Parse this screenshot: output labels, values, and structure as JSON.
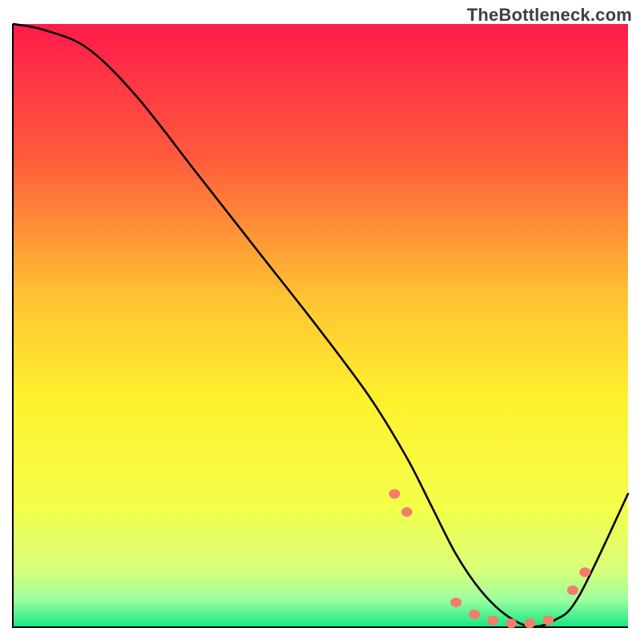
{
  "watermark": "TheBottleneck.com",
  "chart_data": {
    "type": "line",
    "title": "",
    "xlabel": "",
    "ylabel": "",
    "xlim": [
      0,
      100
    ],
    "ylim": [
      0,
      100
    ],
    "gradient_stops": [
      {
        "offset": 0.0,
        "color": "#ff1b4b"
      },
      {
        "offset": 0.22,
        "color": "#ff5a3c"
      },
      {
        "offset": 0.45,
        "color": "#ffc233"
      },
      {
        "offset": 0.62,
        "color": "#fff02e"
      },
      {
        "offset": 0.8,
        "color": "#f4ff4a"
      },
      {
        "offset": 0.905,
        "color": "#d8ff7a"
      },
      {
        "offset": 0.955,
        "color": "#9eff9e"
      },
      {
        "offset": 1.0,
        "color": "#17e884"
      }
    ],
    "series": [
      {
        "name": "bottleneck-curve",
        "x": [
          0,
          5,
          12,
          20,
          30,
          40,
          50,
          58,
          64,
          68,
          72,
          76,
          80,
          84,
          88,
          92,
          100
        ],
        "y": [
          100,
          99,
          96,
          88,
          75,
          62,
          49,
          38,
          28,
          20,
          12,
          6,
          2,
          0,
          1,
          5,
          22
        ]
      }
    ],
    "markers": {
      "name": "highlight-dots",
      "color": "#f47c6a",
      "x": [
        62,
        64,
        72,
        75,
        78,
        81,
        84,
        87,
        91,
        93
      ],
      "y": [
        22,
        19,
        4,
        2,
        1,
        0.5,
        0.5,
        1,
        6,
        9
      ]
    }
  }
}
